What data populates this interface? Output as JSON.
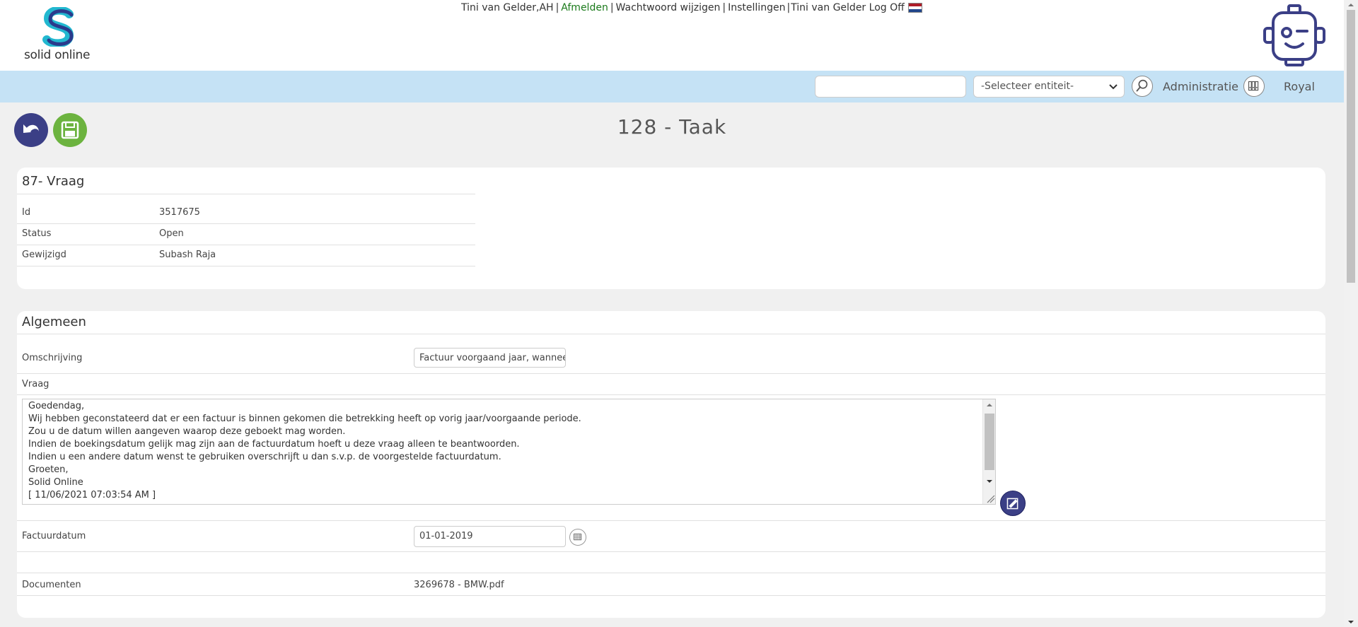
{
  "header": {
    "logo_text": "solid online",
    "user_name": "Tini van Gelder,AH",
    "logout_link": "Afmelden",
    "change_password_link": "Wachtwoord wijzigen",
    "settings_link": "Instellingen",
    "user_logoff_link": "Tini van Gelder Log Off",
    "separator": "|"
  },
  "toolbar": {
    "search_placeholder": "",
    "entity_select_value": "-Selecteer entiteit-",
    "administration_label": "Administratie",
    "company_label": "Royal"
  },
  "page": {
    "title": "128 - Taak"
  },
  "summary_panel": {
    "title": "87- Vraag",
    "rows": [
      {
        "label": "Id",
        "value": "3517675"
      },
      {
        "label": "Status",
        "value": "Open"
      },
      {
        "label": "Gewijzigd",
        "value": "Subash Raja"
      }
    ]
  },
  "general_panel": {
    "title": "Algemeen",
    "description_label": "Omschrijving",
    "description_value": "Factuur voorgaand jaar, wanneer",
    "question_label": "Vraag",
    "question_lines": [
      "Goedendag,",
      "Wij hebben geconstateerd dat er een factuur is binnen gekomen die betrekking heeft op vorig jaar/voorgaande periode.",
      "Zou u de datum willen aangeven waarop deze geboekt mag worden.",
      "Indien de boekingsdatum gelijk mag zijn aan de factuurdatum hoeft u deze vraag alleen te beantwoorden.",
      "Indien u een andere datum wenst te gebruiken overschrijft u dan s.v.p. de voorgestelde factuurdatum.",
      "Groeten,",
      "Solid Online",
      "[ 11/06/2021 07:03:54 AM ]"
    ],
    "invoice_date_label": "Factuurdatum",
    "invoice_date_value": "01-01-2019",
    "documents_label": "Documenten",
    "documents_value": "3269678 - BMW.pdf"
  },
  "colors": {
    "blue_bar": "#c5e2f5",
    "back_button": "#3b3f86",
    "save_button": "#6cb33f",
    "link_green": "#1a7a1a"
  },
  "icons": {
    "back_button": "undo-arrow-icon",
    "save_button": "floppy-disk-icon",
    "search": "magnifier-icon",
    "administration": "binders-icon",
    "calendar": "calendar-icon",
    "question_action": "edit-icon",
    "flag": "netherlands-flag-icon",
    "robot": "robot-mascot-icon"
  }
}
